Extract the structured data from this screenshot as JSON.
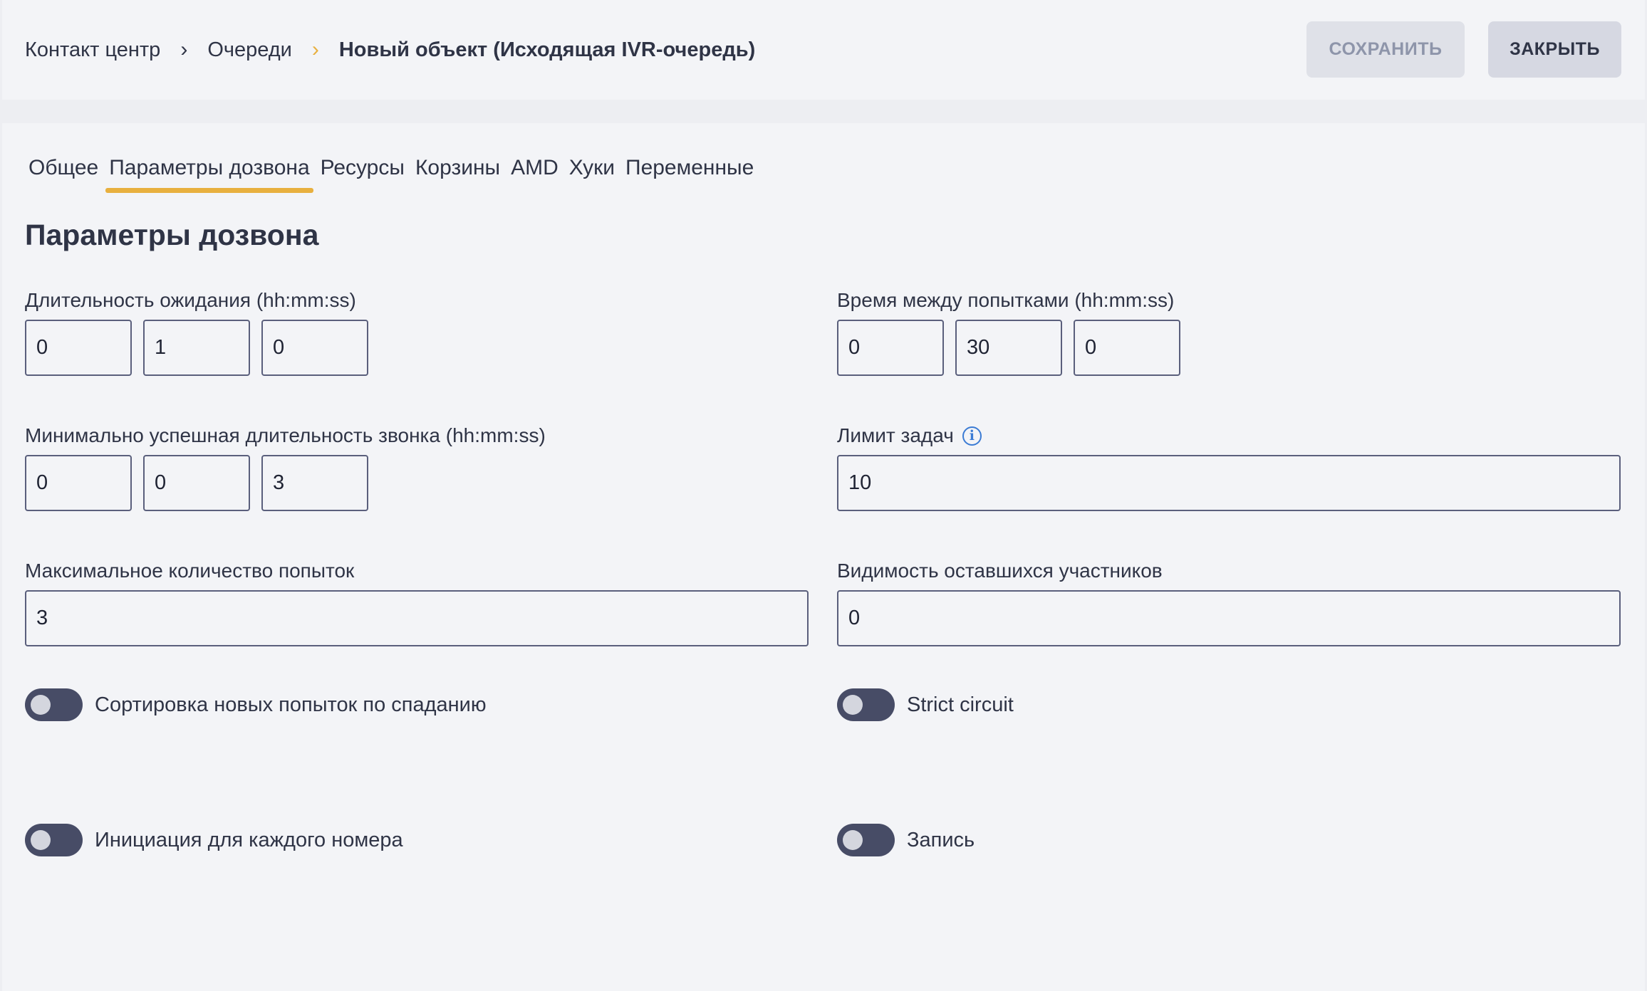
{
  "breadcrumb": {
    "items": [
      "Контакт центр",
      "Очереди"
    ],
    "current": "Новый объект (Исходящая IVR-очередь)"
  },
  "actions": {
    "save": "СОХРАНИТЬ",
    "close": "ЗАКРЫТЬ"
  },
  "tabs": [
    "Общее",
    "Параметры дозвона",
    "Ресурсы",
    "Корзины",
    "AMD",
    "Хуки",
    "Переменные"
  ],
  "active_tab": "Параметры дозвона",
  "section_title": "Параметры дозвона",
  "fields": {
    "wait_duration": {
      "label": "Длительность ожидания (hh:mm:ss)",
      "values": [
        "0",
        "1",
        "0"
      ]
    },
    "retry_interval": {
      "label": "Время между попытками (hh:mm:ss)",
      "values": [
        "0",
        "30",
        "0"
      ]
    },
    "min_success_duration": {
      "label": "Минимально успешная длительность звонка (hh:mm:ss)",
      "values": [
        "0",
        "0",
        "3"
      ]
    },
    "task_limit": {
      "label": "Лимит задач",
      "value": "10"
    },
    "max_attempts": {
      "label": "Максимальное количество попыток",
      "value": "3"
    },
    "remaining_visibility": {
      "label": "Видимость оставшихся участников",
      "value": "0"
    }
  },
  "toggles": {
    "sort_desc": {
      "label": "Сортировка новых попыток по спаданию",
      "on": false
    },
    "strict_circuit": {
      "label": "Strict circuit",
      "on": false
    },
    "per_number_init": {
      "label": "Инициация для каждого номера",
      "on": false
    },
    "recording": {
      "label": "Запись",
      "on": false
    }
  },
  "colors": {
    "accent": "#e8b03f",
    "toggle_off": "#474c66",
    "info": "#3b7bd4"
  }
}
